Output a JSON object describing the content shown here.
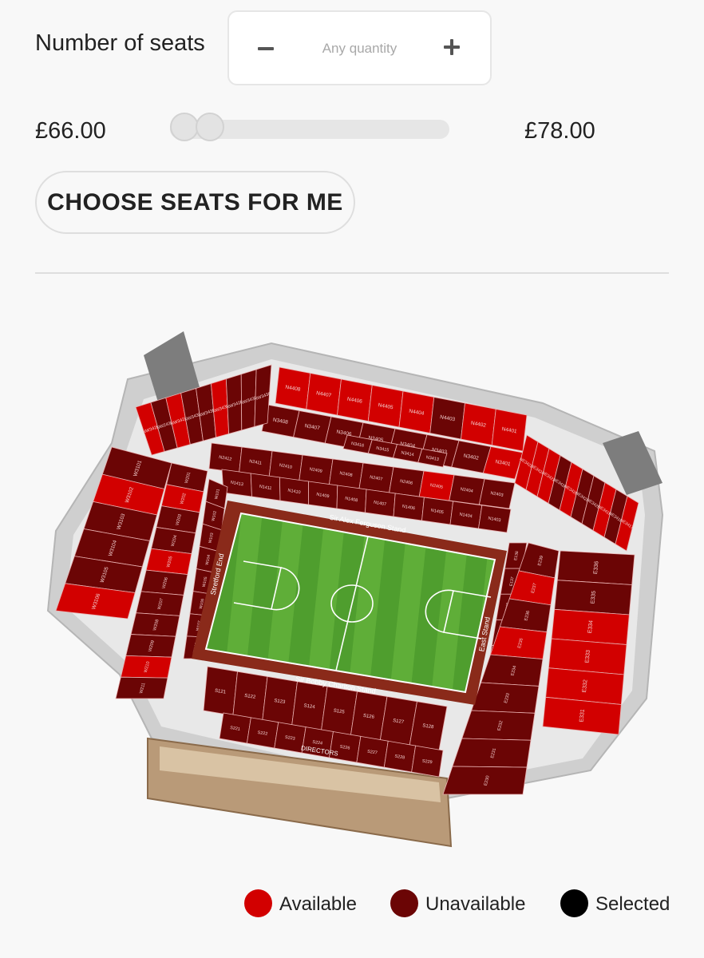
{
  "quantity": {
    "label": "Number of seats",
    "placeholder": "Any quantity"
  },
  "price_filter": {
    "min_label": "£66.00",
    "max_label": "£78.00",
    "range_low_fraction": 0.0,
    "range_high_fraction": 0.0
  },
  "choose_button_label": "CHOOSE SEATS FOR ME",
  "stadium": {
    "stand_labels": {
      "north": "Sir Alex Ferguson Stand",
      "south": "Sir Bobby Charlton Stand",
      "west": "Stretford End",
      "east": "East Stand"
    },
    "directors_label": "DIRECTORS",
    "sections": {
      "north_upper": [
        {
          "id": "N4408",
          "status": "available"
        },
        {
          "id": "N4407",
          "status": "available"
        },
        {
          "id": "N4406",
          "status": "available"
        },
        {
          "id": "N4405",
          "status": "available"
        },
        {
          "id": "N4404",
          "status": "available"
        },
        {
          "id": "N4403",
          "status": "unavailable"
        },
        {
          "id": "N4402",
          "status": "available"
        },
        {
          "id": "N4401",
          "status": "available"
        }
      ],
      "north_mid": [
        {
          "id": "N3408",
          "status": "unavailable"
        },
        {
          "id": "N3407",
          "status": "unavailable"
        },
        {
          "id": "N3406",
          "status": "unavailable"
        },
        {
          "id": "N3405",
          "status": "unavailable"
        },
        {
          "id": "N3404",
          "status": "unavailable"
        },
        {
          "id": "N3403",
          "status": "unavailable"
        },
        {
          "id": "N3402",
          "status": "unavailable"
        },
        {
          "id": "N3401",
          "status": "available"
        }
      ],
      "north_lower_row1": [
        {
          "id": "N2412",
          "status": "unavailable"
        },
        {
          "id": "N2411",
          "status": "unavailable"
        },
        {
          "id": "N2410",
          "status": "unavailable"
        },
        {
          "id": "N2409",
          "status": "unavailable"
        },
        {
          "id": "N2408",
          "status": "unavailable"
        },
        {
          "id": "N2407",
          "status": "unavailable"
        },
        {
          "id": "N2406",
          "status": "unavailable"
        },
        {
          "id": "N2405",
          "status": "available"
        },
        {
          "id": "N2404",
          "status": "unavailable"
        },
        {
          "id": "N2403",
          "status": "unavailable"
        }
      ],
      "north_lower_row2": [
        {
          "id": "N1413",
          "status": "unavailable"
        },
        {
          "id": "N1411",
          "status": "unavailable"
        },
        {
          "id": "N1410",
          "status": "unavailable"
        },
        {
          "id": "N1409",
          "status": "unavailable"
        },
        {
          "id": "N1408",
          "status": "unavailable"
        },
        {
          "id": "N1407",
          "status": "unavailable"
        },
        {
          "id": "N1406",
          "status": "unavailable"
        },
        {
          "id": "N1405",
          "status": "unavailable"
        },
        {
          "id": "N1404",
          "status": "unavailable"
        },
        {
          "id": "N1403",
          "status": "unavailable"
        }
      ],
      "north_small": [
        "N3416",
        "N3415",
        "N3414",
        "N3413"
      ],
      "northwest": [
        {
          "id": "NW3429",
          "status": "available"
        },
        {
          "id": "NW2430",
          "status": "unavailable"
        },
        {
          "id": "NW3427",
          "status": "available"
        },
        {
          "id": "NW3431",
          "status": "unavailable"
        },
        {
          "id": "NW3435",
          "status": "unavailable"
        },
        {
          "id": "NW3432",
          "status": "available"
        },
        {
          "id": "NW3428",
          "status": "unavailable"
        },
        {
          "id": "NW3433",
          "status": "unavailable"
        },
        {
          "id": "NW3436",
          "status": "unavailable"
        }
      ],
      "northeast": [
        {
          "id": "NE3422",
          "status": "available"
        },
        {
          "id": "NE3424",
          "status": "available"
        },
        {
          "id": "NE3421",
          "status": "available"
        },
        {
          "id": "NE3426",
          "status": "unavailable"
        },
        {
          "id": "NE3420",
          "status": "available"
        },
        {
          "id": "NE3423",
          "status": "unavailable"
        },
        {
          "id": "NE3425",
          "status": "unavailable"
        },
        {
          "id": "NE3419",
          "status": "available"
        },
        {
          "id": "NE3418",
          "status": "unavailable"
        },
        {
          "id": "NE3417",
          "status": "available"
        }
      ],
      "west_upper": [
        {
          "id": "W3101",
          "status": "unavailable"
        },
        {
          "id": "W3102",
          "status": "available"
        },
        {
          "id": "W3103",
          "status": "unavailable"
        },
        {
          "id": "W3104",
          "status": "unavailable"
        },
        {
          "id": "W3105",
          "status": "unavailable"
        },
        {
          "id": "W3106",
          "status": "available"
        }
      ],
      "west_lower": [
        {
          "id": "W201",
          "status": "unavailable"
        },
        {
          "id": "W202",
          "status": "available"
        },
        {
          "id": "W203",
          "status": "unavailable"
        },
        {
          "id": "W204",
          "status": "unavailable"
        },
        {
          "id": "W205",
          "status": "available"
        },
        {
          "id": "W206",
          "status": "unavailable"
        },
        {
          "id": "W207",
          "status": "unavailable"
        },
        {
          "id": "W208",
          "status": "unavailable"
        },
        {
          "id": "W209",
          "status": "unavailable"
        },
        {
          "id": "W210",
          "status": "available"
        },
        {
          "id": "W211",
          "status": "unavailable"
        }
      ],
      "west_pitchside": [
        "W101",
        "W102",
        "W103",
        "W104",
        "W105",
        "W106",
        "W107",
        "W108"
      ],
      "south_lower": [
        {
          "id": "S121",
          "status": "unavailable"
        },
        {
          "id": "S122",
          "status": "unavailable"
        },
        {
          "id": "S123",
          "status": "unavailable"
        },
        {
          "id": "S124",
          "status": "unavailable"
        },
        {
          "id": "S125",
          "status": "unavailable"
        },
        {
          "id": "S126",
          "status": "unavailable"
        },
        {
          "id": "S127",
          "status": "unavailable"
        },
        {
          "id": "S128",
          "status": "unavailable"
        }
      ],
      "south_upper": [
        {
          "id": "S221",
          "status": "unavailable"
        },
        {
          "id": "S222",
          "status": "unavailable"
        },
        {
          "id": "S223",
          "status": "unavailable"
        },
        {
          "id": "S224",
          "status": "unavailable"
        },
        {
          "id": "S226",
          "status": "unavailable"
        },
        {
          "id": "S227",
          "status": "unavailable"
        },
        {
          "id": "S228",
          "status": "unavailable"
        },
        {
          "id": "S229",
          "status": "unavailable"
        }
      ],
      "east_lower": [
        {
          "id": "E138",
          "status": "unavailable"
        },
        {
          "id": "E137",
          "status": "unavailable"
        },
        {
          "id": "E136",
          "status": "unavailable"
        },
        {
          "id": "E135",
          "status": "unavailable"
        },
        {
          "id": "E134",
          "status": "unavailable"
        },
        {
          "id": "E133",
          "status": "unavailable"
        },
        {
          "id": "E132",
          "status": "unavailable"
        }
      ],
      "east_mid": [
        {
          "id": "E239",
          "status": "unavailable"
        },
        {
          "id": "E237",
          "status": "available"
        },
        {
          "id": "E236",
          "status": "unavailable"
        },
        {
          "id": "E235",
          "status": "available"
        },
        {
          "id": "E234",
          "status": "unavailable"
        },
        {
          "id": "E233",
          "status": "unavailable"
        },
        {
          "id": "E232",
          "status": "unavailable"
        },
        {
          "id": "E231",
          "status": "unavailable"
        },
        {
          "id": "E230",
          "status": "unavailable"
        }
      ],
      "east_upper": [
        {
          "id": "E336",
          "status": "unavailable"
        },
        {
          "id": "E335",
          "status": "unavailable"
        },
        {
          "id": "E334",
          "status": "available"
        },
        {
          "id": "E333",
          "status": "available"
        },
        {
          "id": "E332",
          "status": "available"
        },
        {
          "id": "E331",
          "status": "available"
        }
      ]
    }
  },
  "legend": [
    {
      "label": "Available",
      "color": "#d20000"
    },
    {
      "label": "Unavailable",
      "color": "#6b0505"
    },
    {
      "label": "Selected",
      "color": "#000000"
    }
  ]
}
